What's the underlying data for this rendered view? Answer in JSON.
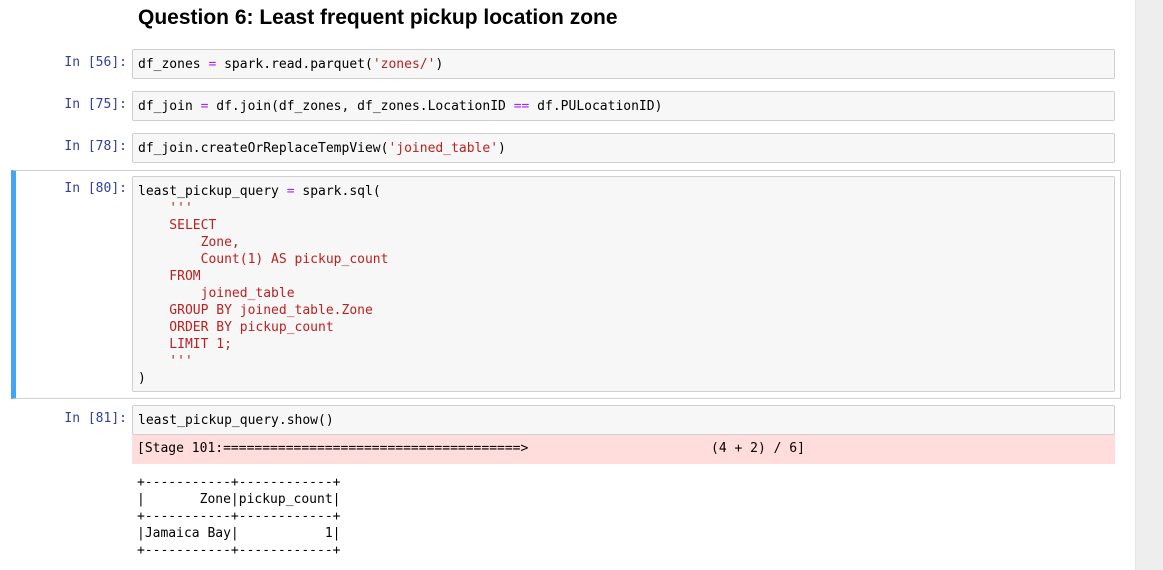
{
  "heading": "Question 6: Least frequent pickup location zone",
  "cells": [
    {
      "prompt": "In [56]:",
      "code": {
        "a": "df_zones ",
        "op": "=",
        "b": " spark.read.parquet(",
        "s": "'zones/'",
        "c": ")"
      }
    },
    {
      "prompt": "In [75]:",
      "code": {
        "a": "df_join ",
        "op": "=",
        "b": " df.join(df_zones, df_zones.LocationID ",
        "op2": "==",
        "c": " df.PULocationID)"
      }
    },
    {
      "prompt": "In [78]:",
      "code": {
        "a": "df_join.createOrReplaceTempView(",
        "s": "'joined_table'",
        "c": ")"
      }
    },
    {
      "prompt": "In [80]:",
      "code": {
        "line1a": "least_pickup_query ",
        "op": "=",
        "line1b": " spark.sql(",
        "sql_lines": [
          "    '''",
          "    SELECT",
          "        Zone,",
          "        Count(1) AS pickup_count",
          "    FROM",
          "        joined_table",
          "    GROUP BY joined_table.Zone",
          "    ORDER BY pickup_count",
          "    LIMIT 1;",
          "    '''"
        ],
        "close": ")"
      }
    },
    {
      "prompt": "In [81]:",
      "code": {
        "a": "least_pickup_query.show()"
      }
    }
  ],
  "stderr": {
    "stage_text": "[Stage 101:======================================>",
    "progress_text": "(4 + 2) / 6]"
  },
  "output": {
    "lines": [
      "+-----------+------------+",
      "|       Zone|pickup_count|",
      "+-----------+------------+",
      "|Jamaica Bay|           1|",
      "+-----------+------------+"
    ]
  }
}
